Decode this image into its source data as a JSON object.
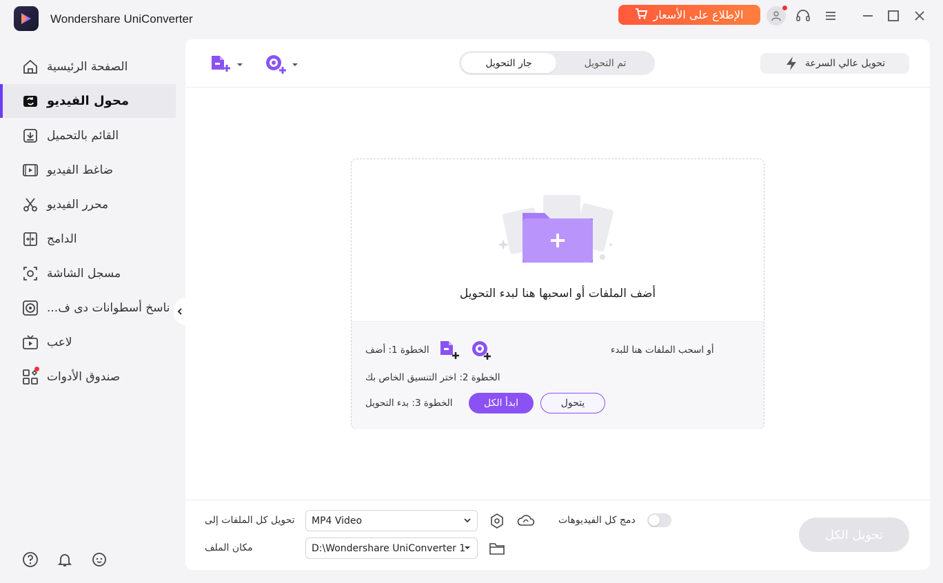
{
  "window": {
    "title": "Wondershare UniConverter",
    "promo_label": "الإطلاع على الأسعار",
    "colors": {
      "accent": "#8a52f4",
      "promo": "#ff5a3b"
    }
  },
  "sidebar": {
    "items": [
      {
        "label": "الصفحة الرئيسية",
        "icon": "home-icon"
      },
      {
        "label": "محول الفيديو",
        "icon": "video-converter-icon",
        "active": true
      },
      {
        "label": "القائم بالتحميل",
        "icon": "download-icon"
      },
      {
        "label": "ضاغط الفيديو",
        "icon": "compress-icon"
      },
      {
        "label": "محرر الفيديو",
        "icon": "scissors-icon"
      },
      {
        "label": "الدامج",
        "icon": "merge-icon"
      },
      {
        "label": "مسجل الشاشة",
        "icon": "screen-record-icon"
      },
      {
        "label": "ناسخ أسطوانات دى ف...",
        "icon": "dvd-icon"
      },
      {
        "label": "لاعب",
        "icon": "player-icon"
      },
      {
        "label": "صندوق الأدوات",
        "icon": "toolbox-icon"
      }
    ]
  },
  "toolbar": {
    "tab_converting": "جار التحويل",
    "tab_finished": "تم التحويل",
    "high_speed": "تحويل عالي السرعة"
  },
  "dropzone": {
    "main_text": "أضف الملفات أو اسحبها هنا لبدء التحويل",
    "step1_prefix": "الخطوة 1: أضف",
    "step1_suffix": "أو اسحب الملفات هنا للبدء",
    "step2": "الخطوة 2: اختر التنسيق الخاص بك",
    "step3": "الخطوة 3: بدء التحويل",
    "start_all": "ابدأ الكل",
    "convert": "يتحول"
  },
  "bottom": {
    "convert_all_to_label": "تحويل كل الملفات إلى",
    "format_value": "MP4 Video",
    "file_location_label": "مكان الملف",
    "location_value": "D:\\Wondershare UniConverter 1",
    "merge_label": "دمج كل الفيديوهات",
    "convert_all_button": "تحويل الكل"
  }
}
